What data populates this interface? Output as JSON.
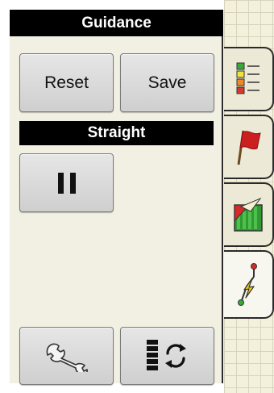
{
  "header": {
    "title": "Guidance"
  },
  "buttons": {
    "reset_label": "Reset",
    "save_label": "Save"
  },
  "section": {
    "title": "Straight"
  },
  "tabs": [
    {
      "icon": "checklist-icon",
      "active": false
    },
    {
      "icon": "flag-icon",
      "active": false
    },
    {
      "icon": "field-map-icon",
      "active": false
    },
    {
      "icon": "guidance-path-icon",
      "active": true
    }
  ],
  "bottom_buttons": [
    {
      "icon": "wrench-icon"
    },
    {
      "icon": "cycle-icon"
    }
  ],
  "colors": {
    "panel_bg": "#f1f0e2",
    "header_bg": "#000000",
    "flag_red": "#cc1f1f",
    "map_green": "#2f9a2f",
    "path_yellow": "#f5d21a"
  }
}
